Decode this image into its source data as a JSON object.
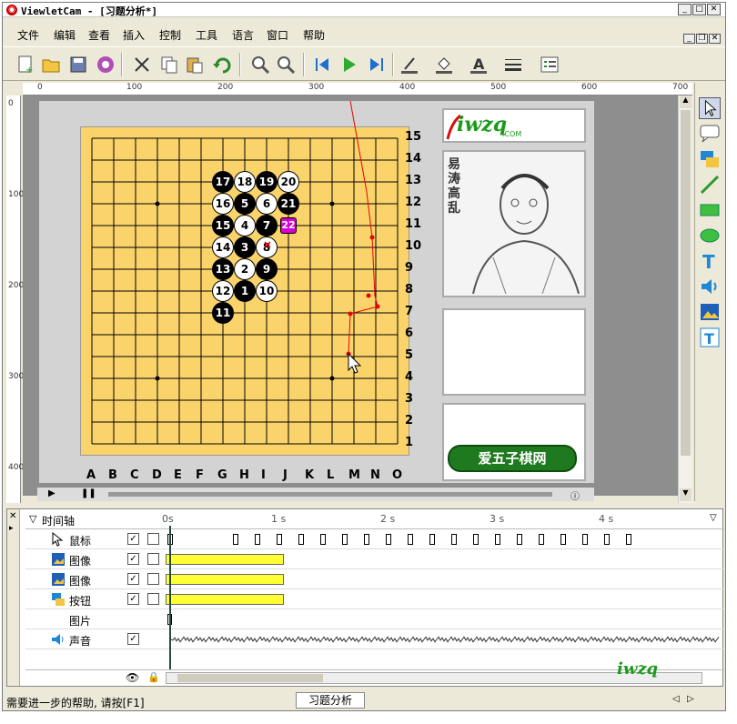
{
  "window": {
    "title": "ViewletCam - [习题分析*]"
  },
  "menu": [
    "文件",
    "编辑",
    "查看",
    "插入",
    "控制",
    "工具",
    "语言",
    "窗口",
    "帮助"
  ],
  "ruler_h": [
    "0",
    "100",
    "200",
    "300",
    "400",
    "500",
    "600",
    "700"
  ],
  "ruler_v": [
    "0",
    "100",
    "200",
    "300",
    "400"
  ],
  "board": {
    "rows": [
      "15",
      "14",
      "13",
      "12",
      "11",
      "10",
      "9",
      "8",
      "7",
      "6",
      "5",
      "4",
      "3",
      "2",
      "1"
    ],
    "cols": [
      "A",
      "B",
      "C",
      "D",
      "E",
      "F",
      "G",
      "H",
      "I",
      "J",
      "K",
      "L",
      "M",
      "N",
      "O"
    ],
    "stones": [
      {
        "n": "17",
        "c": "b",
        "col": 6,
        "row": 2
      },
      {
        "n": "18",
        "c": "w",
        "col": 7,
        "row": 2
      },
      {
        "n": "19",
        "c": "b",
        "col": 8,
        "row": 2
      },
      {
        "n": "20",
        "c": "w",
        "col": 9,
        "row": 2
      },
      {
        "n": "16",
        "c": "w",
        "col": 6,
        "row": 3
      },
      {
        "n": "5",
        "c": "b",
        "col": 7,
        "row": 3
      },
      {
        "n": "6",
        "c": "w",
        "col": 8,
        "row": 3
      },
      {
        "n": "21",
        "c": "b",
        "col": 9,
        "row": 3
      },
      {
        "n": "15",
        "c": "b",
        "col": 6,
        "row": 4
      },
      {
        "n": "4",
        "c": "w",
        "col": 7,
        "row": 4
      },
      {
        "n": "7",
        "c": "b",
        "col": 8,
        "row": 4
      },
      {
        "n": "22",
        "c": "m",
        "col": 9,
        "row": 4
      },
      {
        "n": "14",
        "c": "w",
        "col": 6,
        "row": 5
      },
      {
        "n": "3",
        "c": "b",
        "col": 7,
        "row": 5
      },
      {
        "n": "8",
        "c": "w",
        "col": 8,
        "row": 5
      },
      {
        "n": "13",
        "c": "b",
        "col": 6,
        "row": 6
      },
      {
        "n": "2",
        "c": "w",
        "col": 7,
        "row": 6
      },
      {
        "n": "9",
        "c": "b",
        "col": 8,
        "row": 6
      },
      {
        "n": "12",
        "c": "w",
        "col": 6,
        "row": 7
      },
      {
        "n": "1",
        "c": "b",
        "col": 7,
        "row": 7
      },
      {
        "n": "10",
        "c": "w",
        "col": 8,
        "row": 7
      },
      {
        "n": "11",
        "c": "b",
        "col": 6,
        "row": 8
      }
    ]
  },
  "side": {
    "logo": "iwzq",
    "logo_sub": ".COM",
    "portrait_caption": "易涛高乱",
    "button": "爱五子棋网"
  },
  "timeline": {
    "header": "时间轴",
    "ticks": [
      "0s",
      "1 s",
      "2 s",
      "3 s",
      "4 s"
    ],
    "rows": [
      {
        "name": "鼠标",
        "check": "✓"
      },
      {
        "name": "图像",
        "check": "✓"
      },
      {
        "name": "图像",
        "check": "✓"
      },
      {
        "name": "按钮",
        "check": "✓"
      },
      {
        "name": "图片",
        "check": ""
      },
      {
        "name": "声音",
        "check": "✓"
      }
    ]
  },
  "status": {
    "help": "需要进一步的帮助, 请按[F1]",
    "tab": "习题分析"
  }
}
